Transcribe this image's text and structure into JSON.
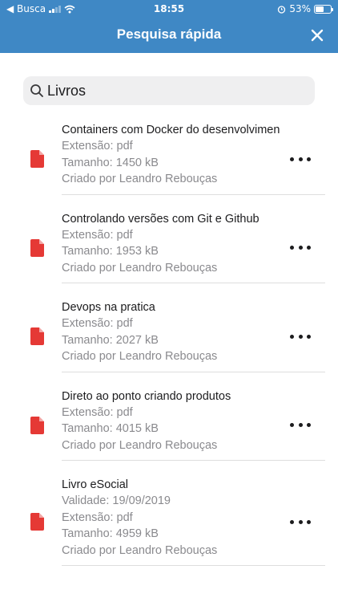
{
  "status_bar": {
    "back_label": "◀ Busca",
    "time": "18:55",
    "battery": "53%",
    "battery_level": 0.53
  },
  "header": {
    "title": "Pesquisa rápida"
  },
  "search": {
    "value": "Livros"
  },
  "items": [
    {
      "title": "Containers com Docker do desenvolvimen",
      "meta": [
        "Extensão: pdf",
        "Tamanho: 1450 kB",
        "Criado por Leandro Rebouças"
      ]
    },
    {
      "title": "Controlando versões com Git e Github",
      "meta": [
        "Extensão: pdf",
        "Tamanho: 1953 kB",
        "Criado por Leandro Rebouças"
      ]
    },
    {
      "title": "Devops na pratica",
      "meta": [
        "Extensão: pdf",
        "Tamanho: 2027 kB",
        "Criado por Leandro Rebouças"
      ]
    },
    {
      "title": "Direto ao ponto criando produtos",
      "meta": [
        "Extensão: pdf",
        "Tamanho: 4015 kB",
        "Criado por Leandro Rebouças"
      ]
    },
    {
      "title": "Livro eSocial",
      "meta": [
        "Validade: 19/09/2019",
        "Extensão: pdf",
        "Tamanho: 4959 kB",
        "Criado por Leandro Rebouças"
      ]
    }
  ],
  "colors": {
    "header": "#3f88c5",
    "pdf_icon": "#e53935"
  }
}
